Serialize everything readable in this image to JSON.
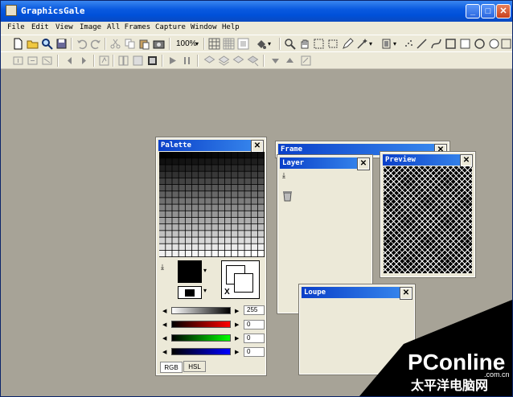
{
  "app": {
    "title": "GraphicsGale"
  },
  "window_controls": {
    "minimize": "_",
    "maximize": "□",
    "close": "✕"
  },
  "menu": [
    "File",
    "Edit",
    "View",
    "Image",
    "All Frames",
    "Capture",
    "Window",
    "Help"
  ],
  "toolbar": {
    "zoom": "100%"
  },
  "palette": {
    "title": "Palette",
    "value_gray": "255",
    "value_r": "0",
    "value_g": "0",
    "value_b": "0",
    "tab_rgb": "RGB",
    "tab_hsl": "HSL",
    "swap_label": "X"
  },
  "frame": {
    "title": "Frame"
  },
  "layer": {
    "title": "Layer"
  },
  "preview": {
    "title": "Preview"
  },
  "loupe": {
    "title": "Loupe"
  },
  "watermark": {
    "brand": "PConline",
    "domain": ".com.cn",
    "chinese": "太平洋电脑网"
  },
  "colors": {
    "title_active": "#0a5ae0",
    "panel_bg": "#ece9d8",
    "workspace": "#a7a397"
  }
}
